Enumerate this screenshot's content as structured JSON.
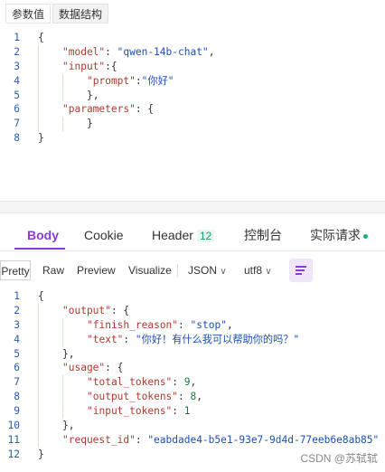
{
  "top_tabs": [
    "参数值",
    "数据结构"
  ],
  "request_code": [
    {
      "n": "1",
      "parts": [
        {
          "t": "{",
          "c": "pun"
        }
      ],
      "indent": 0
    },
    {
      "n": "2",
      "parts": [
        {
          "t": "\"model\"",
          "c": "key"
        },
        {
          "t": ": ",
          "c": "pun"
        },
        {
          "t": "\"qwen-14b-chat\"",
          "c": "str"
        },
        {
          "t": ",",
          "c": "pun"
        }
      ],
      "indent": 1
    },
    {
      "n": "3",
      "parts": [
        {
          "t": "\"input\"",
          "c": "key"
        },
        {
          "t": ":{",
          "c": "pun"
        }
      ],
      "indent": 1
    },
    {
      "n": "4",
      "parts": [
        {
          "t": "\"prompt\"",
          "c": "key"
        },
        {
          "t": ":",
          "c": "pun"
        },
        {
          "t": "\"你好\"",
          "c": "str"
        }
      ],
      "indent": 2
    },
    {
      "n": "5",
      "parts": [
        {
          "t": "},",
          "c": "pun"
        }
      ],
      "indent": 2
    },
    {
      "n": "6",
      "parts": [
        {
          "t": "\"parameters\"",
          "c": "key"
        },
        {
          "t": ": {",
          "c": "pun"
        }
      ],
      "indent": 1
    },
    {
      "n": "7",
      "parts": [
        {
          "t": "}",
          "c": "pun"
        }
      ],
      "indent": 2
    },
    {
      "n": "8",
      "parts": [
        {
          "t": "}",
          "c": "pun"
        }
      ],
      "indent": 0
    }
  ],
  "response_tabs": {
    "body": "Body",
    "cookie": "Cookie",
    "header": "Header",
    "header_count": "12",
    "console": "控制台",
    "actual_request": "实际请求"
  },
  "toolbar": {
    "pretty": "Pretty",
    "raw": "Raw",
    "preview": "Preview",
    "visualize": "Visualize",
    "format": "JSON",
    "encoding": "utf8",
    "caret": "∨"
  },
  "response_code": [
    {
      "n": "1",
      "parts": [
        {
          "t": "{",
          "c": "pun"
        }
      ],
      "indent": 0
    },
    {
      "n": "2",
      "parts": [
        {
          "t": "\"output\"",
          "c": "key"
        },
        {
          "t": ": {",
          "c": "pun"
        }
      ],
      "indent": 1
    },
    {
      "n": "3",
      "parts": [
        {
          "t": "\"finish_reason\"",
          "c": "key"
        },
        {
          "t": ": ",
          "c": "pun"
        },
        {
          "t": "\"stop\"",
          "c": "str"
        },
        {
          "t": ",",
          "c": "pun"
        }
      ],
      "indent": 2
    },
    {
      "n": "4",
      "parts": [
        {
          "t": "\"text\"",
          "c": "key"
        },
        {
          "t": ": ",
          "c": "pun"
        },
        {
          "t": "\"你好！有什么我可以帮助你的吗？\"",
          "c": "str"
        }
      ],
      "indent": 2
    },
    {
      "n": "5",
      "parts": [
        {
          "t": "},",
          "c": "pun"
        }
      ],
      "indent": 1
    },
    {
      "n": "6",
      "parts": [
        {
          "t": "\"usage\"",
          "c": "key"
        },
        {
          "t": ": {",
          "c": "pun"
        }
      ],
      "indent": 1
    },
    {
      "n": "7",
      "parts": [
        {
          "t": "\"total_tokens\"",
          "c": "key"
        },
        {
          "t": ": ",
          "c": "pun"
        },
        {
          "t": "9",
          "c": "num"
        },
        {
          "t": ",",
          "c": "pun"
        }
      ],
      "indent": 2
    },
    {
      "n": "8",
      "parts": [
        {
          "t": "\"output_tokens\"",
          "c": "key"
        },
        {
          "t": ": ",
          "c": "pun"
        },
        {
          "t": "8",
          "c": "num"
        },
        {
          "t": ",",
          "c": "pun"
        }
      ],
      "indent": 2
    },
    {
      "n": "9",
      "parts": [
        {
          "t": "\"input_tokens\"",
          "c": "key"
        },
        {
          "t": ": ",
          "c": "pun"
        },
        {
          "t": "1",
          "c": "num"
        }
      ],
      "indent": 2
    },
    {
      "n": "10",
      "parts": [
        {
          "t": "},",
          "c": "pun"
        }
      ],
      "indent": 1
    },
    {
      "n": "11",
      "parts": [
        {
          "t": "\"request_id\"",
          "c": "key"
        },
        {
          "t": ": ",
          "c": "pun"
        },
        {
          "t": "\"eabdade4-b5e1-93e7-9d4d-77eeb6e8ab85\"",
          "c": "str"
        }
      ],
      "indent": 1
    },
    {
      "n": "12",
      "parts": [
        {
          "t": "}",
          "c": "pun"
        }
      ],
      "indent": 0
    }
  ],
  "watermark": "CSDN @苏轼轼",
  "colors": {
    "accent": "#8a3ad6",
    "key": "#b03a2e",
    "string": "#1b4fb5",
    "number": "#1a7a3a",
    "status_dot": "#19b07f"
  }
}
